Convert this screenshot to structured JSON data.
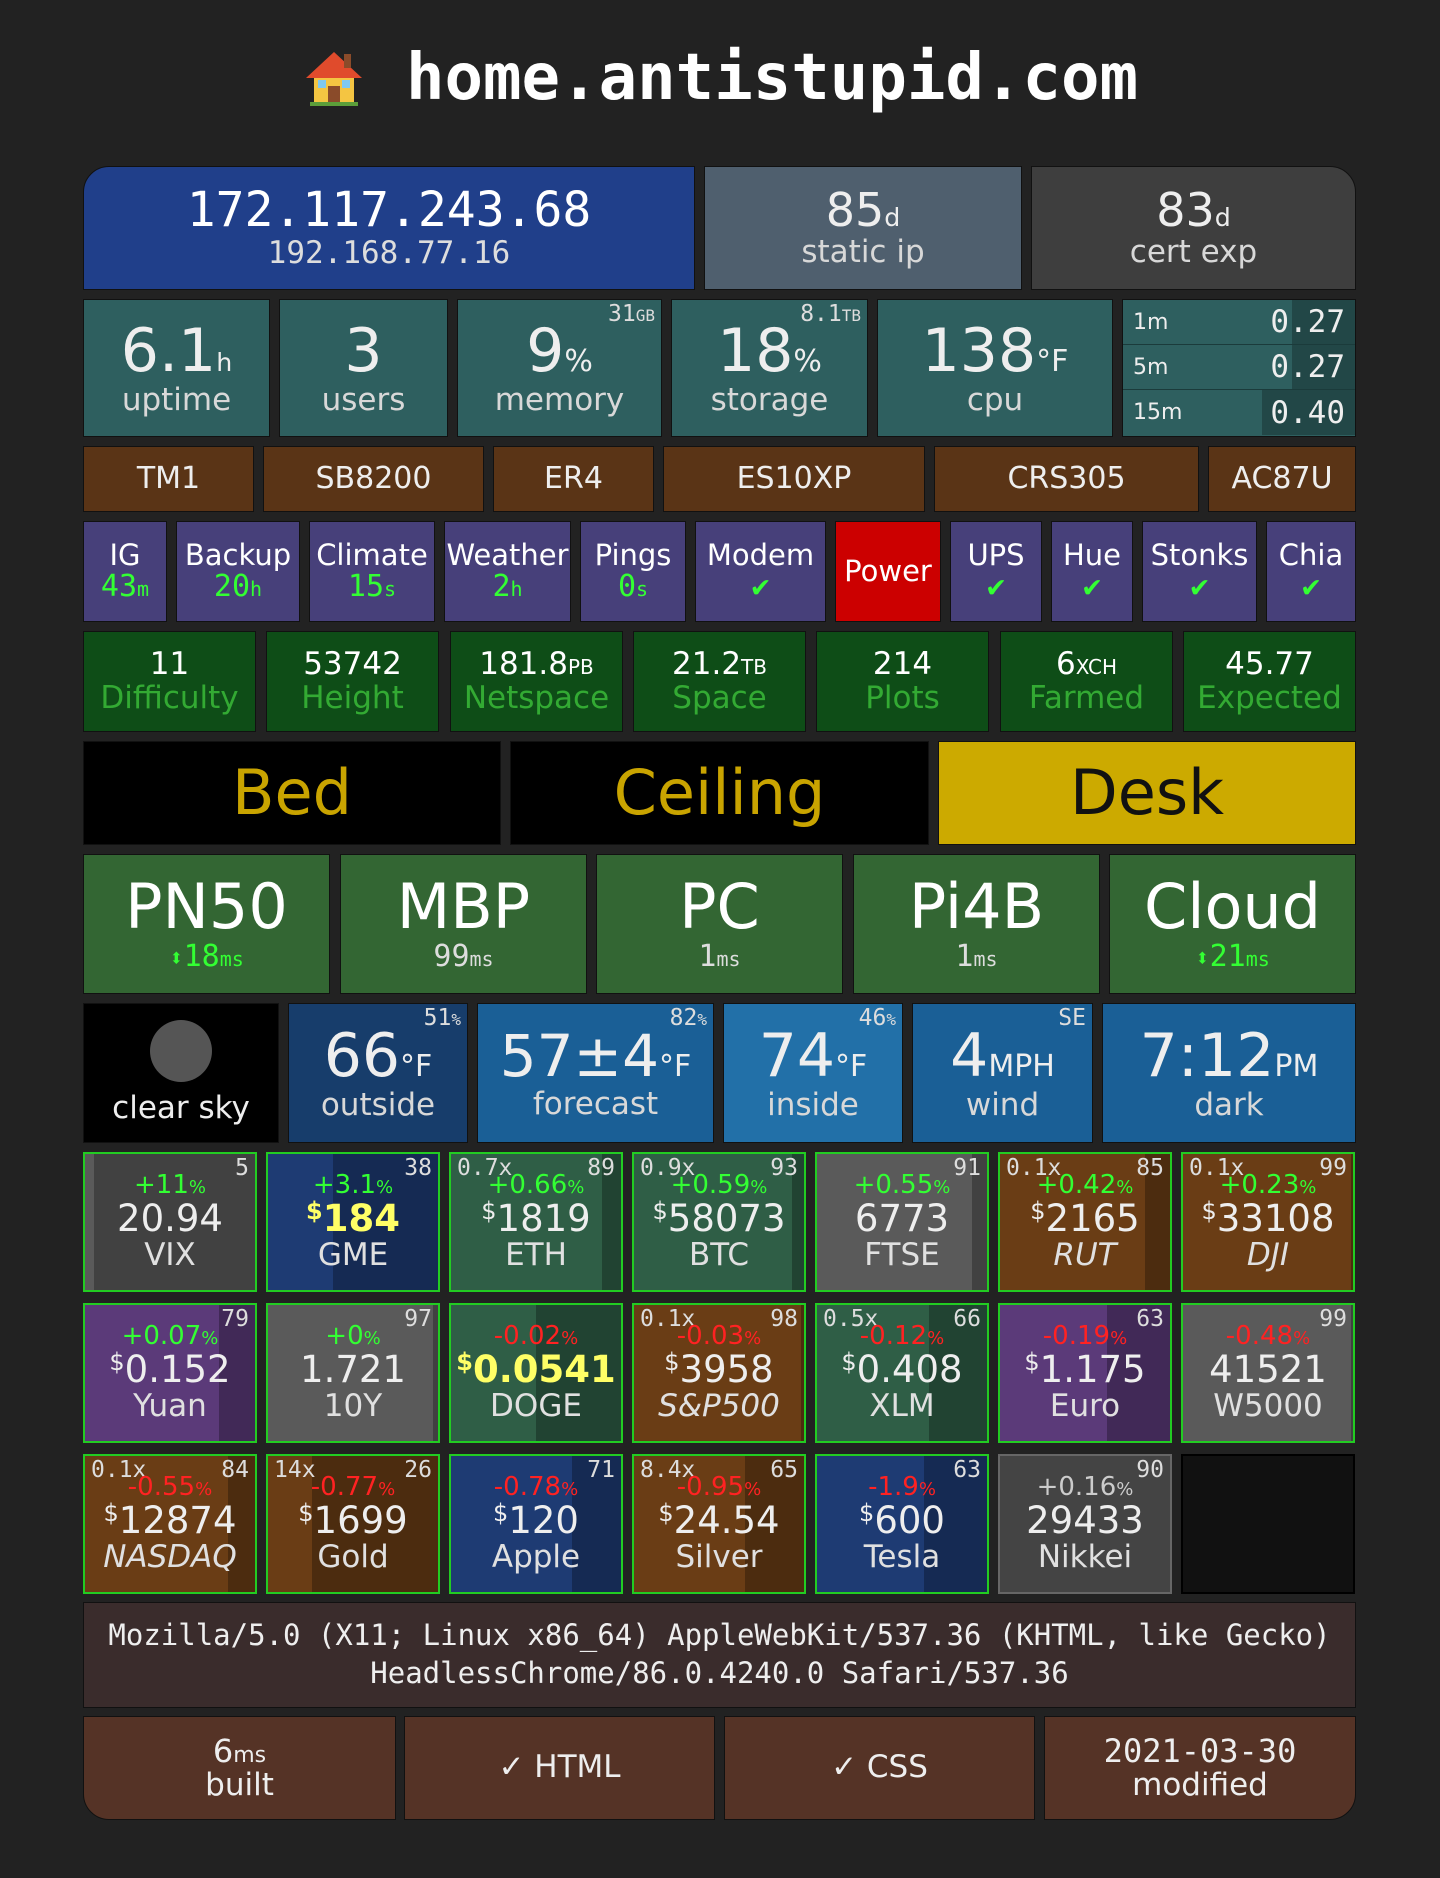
{
  "site": {
    "icon": "house-emoji",
    "title": "home.antistupid.com"
  },
  "network": {
    "public_ip": "172.117.243.68",
    "local_ip": "192.168.77.16",
    "static_days": "85",
    "static_label": "static ip",
    "cert_days": "83",
    "cert_label": "cert exp",
    "days_unit": "d"
  },
  "system": {
    "uptime": {
      "value": "6.1",
      "unit": "h",
      "label": "uptime"
    },
    "users": {
      "value": "3",
      "label": "users"
    },
    "memory": {
      "value": "9",
      "unit": "%",
      "label": "memory",
      "total": "31",
      "total_unit": "GB"
    },
    "storage": {
      "value": "18",
      "unit": "%",
      "label": "storage",
      "total": "8.1",
      "total_unit": "TB"
    },
    "cpu": {
      "value": "138",
      "unit": "°F",
      "label": "cpu"
    },
    "load": [
      {
        "label": "1m",
        "value": "0.27",
        "level": 0.27
      },
      {
        "label": "5m",
        "value": "0.27",
        "level": 0.27
      },
      {
        "label": "15m",
        "value": "0.40",
        "level": 0.4
      }
    ]
  },
  "devices": [
    "TM1",
    "SB8200",
    "ER4",
    "ES10XP",
    "CRS305",
    "AC87U"
  ],
  "services": [
    {
      "name": "IG",
      "value": "43",
      "unit": "m"
    },
    {
      "name": "Backup",
      "value": "20",
      "unit": "h"
    },
    {
      "name": "Climate",
      "value": "15",
      "unit": "s"
    },
    {
      "name": "Weather",
      "value": "2",
      "unit": "h"
    },
    {
      "name": "Pings",
      "value": "0",
      "unit": "s"
    },
    {
      "name": "Modem",
      "value": "✔",
      "unit": ""
    },
    {
      "name": "Power",
      "value": "",
      "unit": ""
    },
    {
      "name": "UPS",
      "value": "✔",
      "unit": ""
    },
    {
      "name": "Hue",
      "value": "✔",
      "unit": ""
    },
    {
      "name": "Stonks",
      "value": "✔",
      "unit": ""
    },
    {
      "name": "Chia",
      "value": "✔",
      "unit": ""
    }
  ],
  "chia": [
    {
      "value": "11",
      "unit": "",
      "label": "Difficulty"
    },
    {
      "value": "53742",
      "unit": "",
      "label": "Height"
    },
    {
      "value": "181.8",
      "unit": "PB",
      "label": "Netspace"
    },
    {
      "value": "21.2",
      "unit": "TB",
      "label": "Space"
    },
    {
      "value": "214",
      "unit": "",
      "label": "Plots"
    },
    {
      "value": "6",
      "unit": "XCH",
      "label": "Farmed"
    },
    {
      "value": "45.77",
      "unit": "",
      "label": "Expected"
    }
  ],
  "lights": [
    {
      "name": "Bed",
      "on": false
    },
    {
      "name": "Ceiling",
      "on": false
    },
    {
      "name": "Desk",
      "on": true
    }
  ],
  "hosts": [
    {
      "name": "PN50",
      "arrow": "⬍",
      "ping": "18",
      "unit": "ms"
    },
    {
      "name": "MBP",
      "arrow": "",
      "ping": "99",
      "unit": "ms"
    },
    {
      "name": "PC",
      "arrow": "",
      "ping": "1",
      "unit": "ms"
    },
    {
      "name": "Pi4B",
      "arrow": "",
      "ping": "1",
      "unit": "ms"
    },
    {
      "name": "Cloud",
      "arrow": "⬍",
      "ping": "21",
      "unit": "ms"
    }
  ],
  "weather": {
    "sky": "clear sky",
    "outside": {
      "value": "66",
      "unit": "°F",
      "label": "outside",
      "humidity": "51"
    },
    "forecast": {
      "value": "57±4",
      "unit": "°F",
      "label": "forecast",
      "humidity": "82"
    },
    "inside": {
      "value": "74",
      "unit": "°F",
      "label": "inside",
      "humidity": "46"
    },
    "wind": {
      "value": "4",
      "unit": "MPH",
      "label": "wind",
      "dir": "SE"
    },
    "time": {
      "value": "7:12",
      "unit": "PM",
      "label": "dark"
    },
    "pct_unit": "%"
  },
  "tickers": [
    {
      "change": "+11",
      "dir": "up",
      "price": "20.94",
      "dollar": false,
      "name": "VIX",
      "rank": "5",
      "lev": "",
      "bg": "#5a5a5a",
      "fill": 0.95,
      "hl": false,
      "it": false
    },
    {
      "change": "+3.1",
      "dir": "up",
      "price": "184",
      "dollar": true,
      "name": "GME",
      "rank": "38",
      "lev": "",
      "bg": "#1e3b73",
      "fill": 0.62,
      "hl": true,
      "it": false
    },
    {
      "change": "+0.66",
      "dir": "up",
      "price": "1819",
      "dollar": true,
      "name": "ETH",
      "rank": "89",
      "lev": "0.7x",
      "bg": "#2f5e46",
      "fill": 0.11,
      "hl": false,
      "it": false
    },
    {
      "change": "+0.59",
      "dir": "up",
      "price": "58073",
      "dollar": true,
      "name": "BTC",
      "rank": "93",
      "lev": "0.9x",
      "bg": "#2f5e46",
      "fill": 0.07,
      "hl": false,
      "it": false
    },
    {
      "change": "+0.55",
      "dir": "up",
      "price": "6773",
      "dollar": false,
      "name": "FTSE",
      "rank": "91",
      "lev": "",
      "bg": "#5a5a5a",
      "fill": 0.09,
      "hl": false,
      "it": false
    },
    {
      "change": "+0.42",
      "dir": "up",
      "price": "2165",
      "dollar": true,
      "name": "RUT",
      "rank": "85",
      "lev": "0.1x",
      "bg": "#6a3d15",
      "fill": 0.15,
      "hl": false,
      "it": true
    },
    {
      "change": "+0.23",
      "dir": "up",
      "price": "33108",
      "dollar": true,
      "name": "DJI",
      "rank": "99",
      "lev": "0.1x",
      "bg": "#6a3d15",
      "fill": 0.01,
      "hl": false,
      "it": true
    },
    {
      "change": "+0.07",
      "dir": "up",
      "price": "0.152",
      "dollar": true,
      "name": "Yuan",
      "rank": "79",
      "lev": "",
      "bg": "#5b3a79",
      "fill": 0.21,
      "hl": false,
      "it": false
    },
    {
      "change": "+0",
      "dir": "up",
      "price": "1.721",
      "dollar": false,
      "name": "10Y",
      "rank": "97",
      "lev": "",
      "bg": "#5a5a5a",
      "fill": 0.03,
      "hl": false,
      "it": false
    },
    {
      "change": "-0.02",
      "dir": "down",
      "price": "0.0541",
      "dollar": true,
      "name": "DOGE",
      "rank": "",
      "lev": "",
      "bg": "#2f5e46",
      "fill": 0.5,
      "hl": true,
      "it": false
    },
    {
      "change": "-0.03",
      "dir": "down",
      "price": "3958",
      "dollar": true,
      "name": "S&P500",
      "rank": "98",
      "lev": "0.1x",
      "bg": "#6a3d15",
      "fill": 0.02,
      "hl": false,
      "it": true
    },
    {
      "change": "-0.12",
      "dir": "down",
      "price": "0.408",
      "dollar": true,
      "name": "XLM",
      "rank": "66",
      "lev": "0.5x",
      "bg": "#2f5e46",
      "fill": 0.34,
      "hl": false,
      "it": false
    },
    {
      "change": "-0.19",
      "dir": "down",
      "price": "1.175",
      "dollar": true,
      "name": "Euro",
      "rank": "63",
      "lev": "",
      "bg": "#5b3a79",
      "fill": 0.37,
      "hl": false,
      "it": false
    },
    {
      "change": "-0.48",
      "dir": "down",
      "price": "41521",
      "dollar": false,
      "name": "W5000",
      "rank": "99",
      "lev": "",
      "bg": "#5a5a5a",
      "fill": 0.01,
      "hl": false,
      "it": false
    },
    {
      "change": "-0.55",
      "dir": "down",
      "price": "12874",
      "dollar": true,
      "name": "NASDAQ",
      "rank": "84",
      "lev": "0.1x",
      "bg": "#6a3d15",
      "fill": 0.16,
      "hl": false,
      "it": true
    },
    {
      "change": "-0.77",
      "dir": "down",
      "price": "1699",
      "dollar": true,
      "name": "Gold",
      "rank": "26",
      "lev": "14x",
      "bg": "#6a3d15",
      "fill": 0.74,
      "hl": false,
      "it": false
    },
    {
      "change": "-0.78",
      "dir": "down",
      "price": "120",
      "dollar": true,
      "name": "Apple",
      "rank": "71",
      "lev": "",
      "bg": "#1e3b73",
      "fill": 0.29,
      "hl": false,
      "it": false
    },
    {
      "change": "-0.95",
      "dir": "down",
      "price": "24.54",
      "dollar": true,
      "name": "Silver",
      "rank": "65",
      "lev": "8.4x",
      "bg": "#6a3d15",
      "fill": 0.35,
      "hl": false,
      "it": false
    },
    {
      "change": "-1.9",
      "dir": "down",
      "price": "600",
      "dollar": true,
      "name": "Tesla",
      "rank": "63",
      "lev": "",
      "bg": "#1e3b73",
      "fill": 0.37,
      "hl": false,
      "it": false
    },
    {
      "change": "+0.16",
      "dir": "flat",
      "price": "29433",
      "dollar": false,
      "name": "Nikkei",
      "rank": "90",
      "lev": "",
      "bg": "#444",
      "fill": 0,
      "hl": false,
      "it": false
    }
  ],
  "user_agent": "Mozilla/5.0 (X11; Linux x86_64) AppleWebKit/537.36 (KHTML, like Gecko) HeadlessChrome/86.0.4240.0 Safari/537.36",
  "footer": {
    "built_value": "6",
    "built_unit": "ms",
    "built_label": "built",
    "html": "✓ HTML",
    "css": "✓ CSS",
    "modified_date": "2021-03-30",
    "modified_label": "modified"
  },
  "colors": {
    "public_ip_bg": "#203f8a",
    "static_bg": "#4f5f6e",
    "cert_bg": "#3e3e3e",
    "system_bg": "#2e5f5f",
    "device_bg": "#5a3416",
    "service_bg": "#47407a",
    "service_alert_bg": "#cc0000",
    "chia_bg": "#0e4d17",
    "light_on_bg": "#ccaa00",
    "light_text": "#c9a400",
    "host_bg": "#336633",
    "footer_bg": "#553326",
    "ua_bg": "#3a2c2c"
  }
}
